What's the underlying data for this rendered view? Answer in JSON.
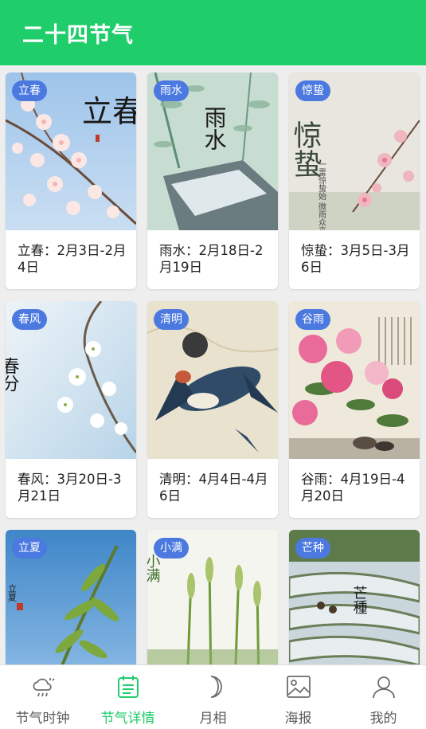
{
  "app_bar": {
    "title": "二十四节气"
  },
  "colors": {
    "accent": "#1fcd6a",
    "tag_bg": "#4c79e0",
    "inactive": "#5a5a5a"
  },
  "cards": [
    {
      "tag": "立春",
      "caption": "立春：2月3日-2月4日",
      "art_text": "立春"
    },
    {
      "tag": "雨水",
      "caption": "雨水：2月18日-2月19日",
      "art_text": "雨水"
    },
    {
      "tag": "惊蛰",
      "caption": "惊蛰：3月5日-3月6日",
      "art_text": "惊蛰",
      "art_subtext": "一雷惊蛰始 微雨众卉新"
    },
    {
      "tag": "春风",
      "caption": "春风：3月20日-3月21日",
      "art_text": "春分"
    },
    {
      "tag": "清明",
      "caption": "清明：4月4日-4月6日"
    },
    {
      "tag": "谷雨",
      "caption": "谷雨：4月19日-4月20日"
    },
    {
      "tag": "立夏",
      "caption": "",
      "art_text": "立夏"
    },
    {
      "tag": "小满",
      "caption": "",
      "art_text": "小满"
    },
    {
      "tag": "芒种",
      "caption": "",
      "art_text": "芒種"
    }
  ],
  "bottom_nav": {
    "items": [
      {
        "label": "节气时钟",
        "icon": "weather-cloud-icon"
      },
      {
        "label": "节气详情",
        "icon": "calendar-list-icon",
        "active": true
      },
      {
        "label": "月相",
        "icon": "crescent-moon-icon"
      },
      {
        "label": "海报",
        "icon": "image-picture-icon"
      },
      {
        "label": "我的",
        "icon": "user-profile-icon"
      }
    ]
  }
}
